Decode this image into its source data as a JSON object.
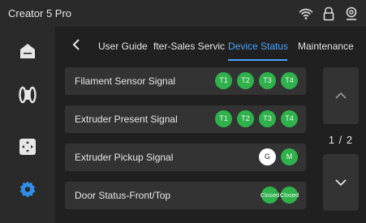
{
  "app": {
    "title": "Creator 5 Pro"
  },
  "topbar": {
    "icons": [
      "wifi-icon",
      "lock-icon",
      "camera-icon"
    ]
  },
  "sidebar": {
    "items": [
      {
        "name": "home-icon",
        "active": false
      },
      {
        "name": "filament-icon",
        "active": false
      },
      {
        "name": "move-icon",
        "active": false
      },
      {
        "name": "settings-icon",
        "active": true
      }
    ]
  },
  "tabs": {
    "back_label": "‹",
    "items": [
      {
        "label": "User Guide",
        "active": false
      },
      {
        "label": "fter-Sales Servic",
        "active": false
      },
      {
        "label": "Device Status",
        "active": true
      },
      {
        "label": "Maintenance",
        "active": false
      }
    ]
  },
  "signals": [
    {
      "label": "Filament Sensor Signal",
      "badges": [
        "T1",
        "T2",
        "T3",
        "T4"
      ]
    },
    {
      "label": "Extruder Present Signal",
      "badges": [
        "T1",
        "T2",
        "T3",
        "T4"
      ]
    },
    {
      "label": "Extruder Pickup Signal",
      "badges": [
        "G",
        "M"
      ]
    },
    {
      "label": "Door Status-Front/Top",
      "badges": [
        "Closed",
        "Closed"
      ]
    }
  ],
  "pager": {
    "current": "1",
    "total": "2",
    "indicator": "1 / 2"
  },
  "colors": {
    "accent": "#4aa3ff",
    "badge_green": "#2fb24c",
    "badge_white": "#ffffff"
  }
}
